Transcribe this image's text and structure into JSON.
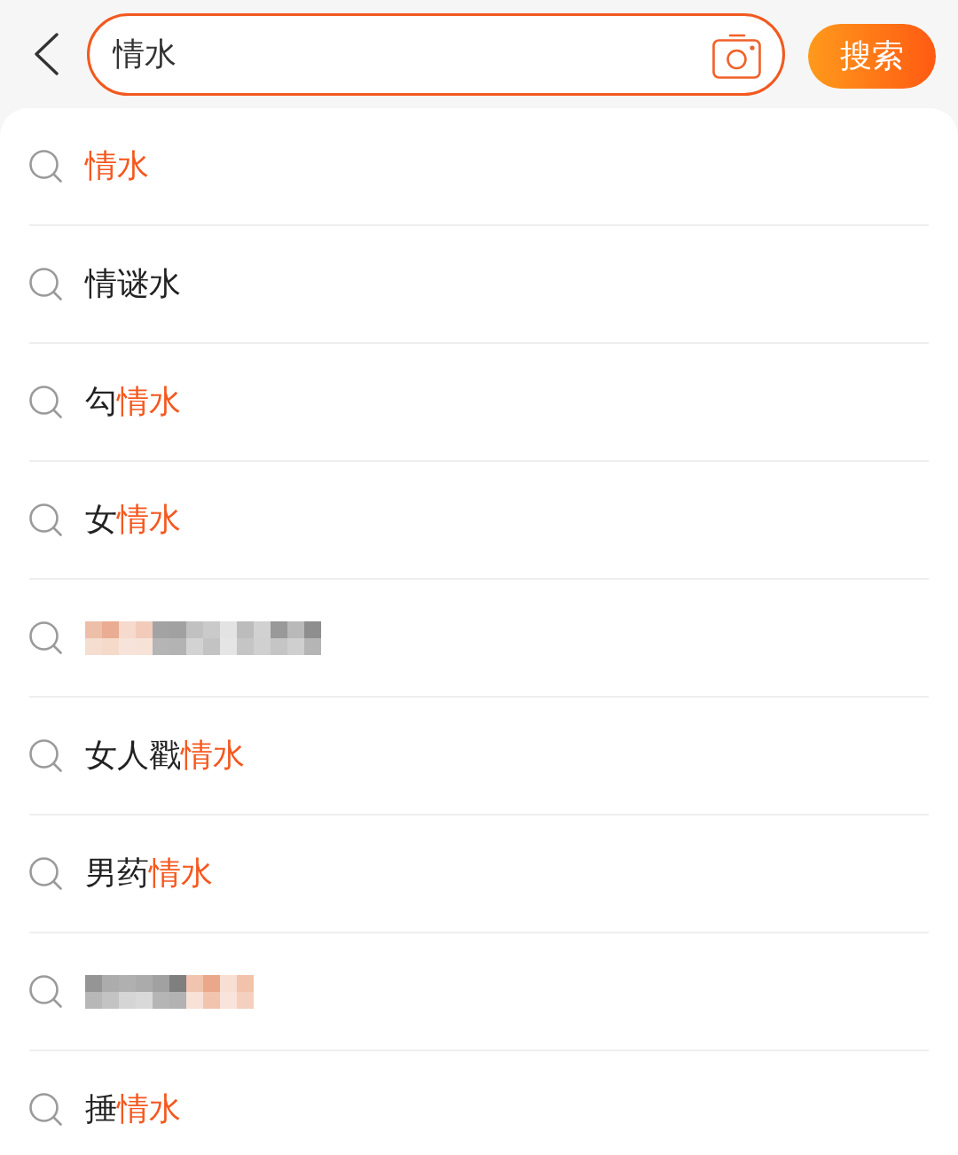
{
  "search": {
    "value": "情水",
    "button": "搜索"
  },
  "suggestions": [
    {
      "kind": "text",
      "segments": [
        {
          "text": "情水",
          "highlight": true
        }
      ]
    },
    {
      "kind": "text",
      "segments": [
        {
          "text": "情谜水",
          "highlight": false
        }
      ]
    },
    {
      "kind": "text",
      "segments": [
        {
          "text": "勾",
          "highlight": false
        },
        {
          "text": "情水",
          "highlight": true
        }
      ]
    },
    {
      "kind": "text",
      "segments": [
        {
          "text": "女",
          "highlight": false
        },
        {
          "text": "情水",
          "highlight": true
        }
      ]
    },
    {
      "kind": "pixelated",
      "mosaic_rows": [
        [
          {
            "color": "#edbfa8"
          },
          {
            "color": "#eaac92"
          },
          {
            "color": "#f5dacd"
          },
          {
            "color": "#f2cbba"
          },
          {
            "color": "#a3a3a3"
          },
          {
            "color": "#a1a1a1"
          },
          {
            "color": "#c1c1c1"
          },
          {
            "color": "#cacaca"
          },
          {
            "color": "#e3e3e3"
          },
          {
            "color": "#bcbcbc"
          },
          {
            "color": "#d1d1d1"
          },
          {
            "color": "#999999"
          },
          {
            "color": "#b9b9b9"
          },
          {
            "color": "#8e8e8e"
          }
        ],
        [
          {
            "color": "#f5ddd0"
          },
          {
            "color": "#f5d9c9"
          },
          {
            "color": "#f7e3da"
          },
          {
            "color": "#f7e2d8"
          },
          {
            "color": "#b5b5b5"
          },
          {
            "color": "#b3b3b3"
          },
          {
            "color": "#d3d3d3"
          },
          {
            "color": "#c3c3c3"
          },
          {
            "color": "#e5e5e5"
          },
          {
            "color": "#c5c5c5"
          },
          {
            "color": "#d0d0d0"
          },
          {
            "color": "#c5c5c5"
          },
          {
            "color": "#cfcfcf"
          },
          {
            "color": "#b5b5b5"
          }
        ]
      ]
    },
    {
      "kind": "text",
      "segments": [
        {
          "text": "女人戳",
          "highlight": false
        },
        {
          "text": "情水",
          "highlight": true
        }
      ]
    },
    {
      "kind": "text",
      "segments": [
        {
          "text": "男药",
          "highlight": false
        },
        {
          "text": "情水",
          "highlight": true
        }
      ]
    },
    {
      "kind": "pixelated",
      "mosaic_rows": [
        [
          {
            "color": "#959595"
          },
          {
            "color": "#acacac"
          },
          {
            "color": "#b0b0b0"
          },
          {
            "color": "#ababab"
          },
          {
            "color": "#a1a1a1"
          },
          {
            "color": "#7f7f7f"
          },
          {
            "color": "#f0c4ae"
          },
          {
            "color": "#eaa789"
          },
          {
            "color": "#f7dfd3"
          },
          {
            "color": "#f2c2aa"
          }
        ],
        [
          {
            "color": "#b7b7b7"
          },
          {
            "color": "#c3c3c3"
          },
          {
            "color": "#d5d5d5"
          },
          {
            "color": "#d9d9d9"
          },
          {
            "color": "#b5b5b5"
          },
          {
            "color": "#b2b2b2"
          },
          {
            "color": "#f8e1d7"
          },
          {
            "color": "#f2c4ae"
          },
          {
            "color": "#f8e4da"
          },
          {
            "color": "#f4d0c0"
          }
        ]
      ]
    },
    {
      "kind": "text",
      "segments": [
        {
          "text": "捶",
          "highlight": false
        },
        {
          "text": "情水",
          "highlight": true
        }
      ]
    }
  ]
}
